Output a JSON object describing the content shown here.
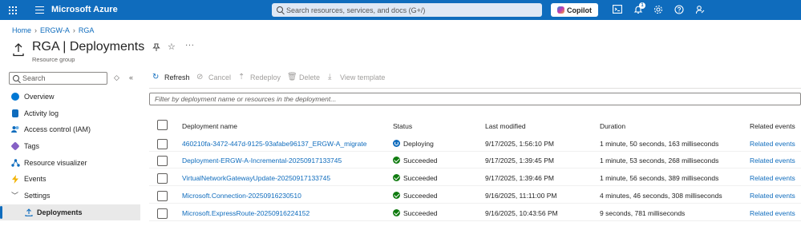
{
  "topbar": {
    "brand": "Microsoft Azure",
    "search_placeholder": "Search resources, services, and docs (G+/)",
    "copilot_label": "Copilot",
    "notification_count": "1",
    "bg_color": "#0f6cbd"
  },
  "breadcrumb": [
    "Home",
    "ERGW-A",
    "RGA"
  ],
  "header": {
    "title": "RGA | Deployments",
    "subtitle": "Resource group"
  },
  "sidebar": {
    "search_placeholder": "Search",
    "items": [
      {
        "label": "Overview",
        "icon": "overview-icon"
      },
      {
        "label": "Activity log",
        "icon": "activity-log-icon"
      },
      {
        "label": "Access control (IAM)",
        "icon": "people-icon"
      },
      {
        "label": "Tags",
        "icon": "tag-icon"
      },
      {
        "label": "Resource visualizer",
        "icon": "visualizer-icon"
      },
      {
        "label": "Events",
        "icon": "bolt-icon"
      },
      {
        "label": "Settings",
        "icon": "chevron-down-icon"
      },
      {
        "label": "Deployments",
        "icon": "upload-icon"
      }
    ]
  },
  "toolbar": {
    "refresh": "Refresh",
    "cancel": "Cancel",
    "redeploy": "Redeploy",
    "delete": "Delete",
    "view_template": "View template"
  },
  "filter_placeholder": "Filter by deployment name or resources in the deployment...",
  "table": {
    "headers": [
      "Deployment name",
      "Status",
      "Last modified",
      "Duration",
      "Related events"
    ],
    "rows": [
      {
        "name": "460210fa-3472-447d-9125-93afabe96137_ERGW-A_migrate",
        "status": "Deploying",
        "status_type": "running",
        "modified": "9/17/2025, 1:56:10 PM",
        "duration": "1 minute, 50 seconds, 163 milliseconds",
        "events": "Related events"
      },
      {
        "name": "Deployment-ERGW-A-Incremental-20250917133745",
        "status": "Succeeded",
        "status_type": "success",
        "modified": "9/17/2025, 1:39:45 PM",
        "duration": "1 minute, 53 seconds, 268 milliseconds",
        "events": "Related events"
      },
      {
        "name": "VirtualNetworkGatewayUpdate-20250917133745",
        "status": "Succeeded",
        "status_type": "success",
        "modified": "9/17/2025, 1:39:46 PM",
        "duration": "1 minute, 56 seconds, 389 milliseconds",
        "events": "Related events"
      },
      {
        "name": "Microsoft.Connection-20250916230510",
        "status": "Succeeded",
        "status_type": "success",
        "modified": "9/16/2025, 11:11:00 PM",
        "duration": "4 minutes, 46 seconds, 308 milliseconds",
        "events": "Related events"
      },
      {
        "name": "Microsoft.ExpressRoute-20250916224152",
        "status": "Succeeded",
        "status_type": "success",
        "modified": "9/16/2025, 10:43:56 PM",
        "duration": "9 seconds, 781 milliseconds",
        "events": "Related events"
      }
    ]
  }
}
